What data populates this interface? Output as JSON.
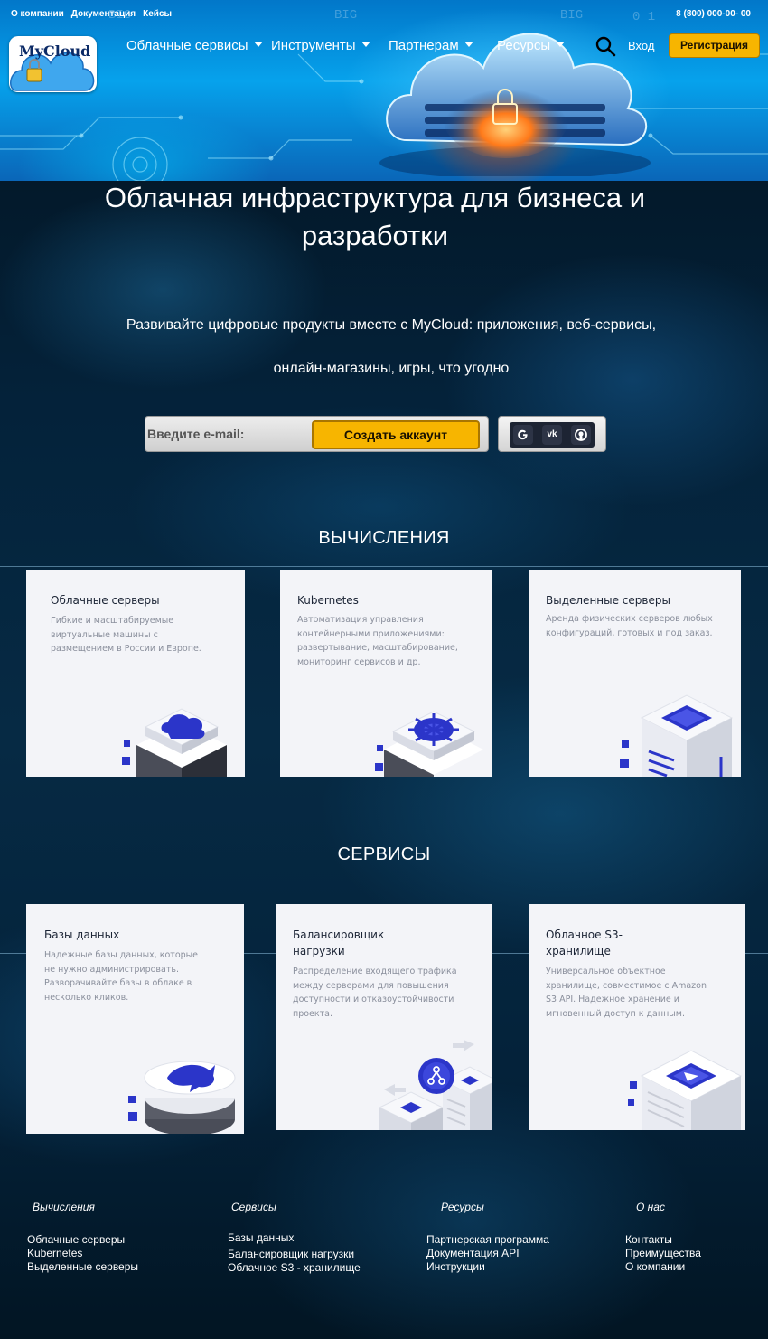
{
  "top_links": [
    "О компании",
    "Документация",
    "Кейсы"
  ],
  "phone": "8 (800) 000-00- 00",
  "logo_text": "MyCloud",
  "nav": [
    {
      "label": "Облачные сервисы"
    },
    {
      "label": "Инструменты"
    },
    {
      "label": "Партнерам"
    },
    {
      "label": "Ресурсы"
    }
  ],
  "login_label": "Вход",
  "register_label": "Регистрация",
  "headline": "Облачная инфраструктура для бизнеса и разработки",
  "subtitle_line1": "Развивайте цифровые продукты вместе с MyCloud: приложения, веб-сервисы,",
  "subtitle_line2": "онлайн-магазины, игры, что угодно",
  "signup": {
    "email_placeholder": "Введите e-mail:",
    "create_label": "Создать аккаунт",
    "social_icons": [
      "google-icon",
      "vk-icon",
      "github-icon"
    ]
  },
  "compute": {
    "title": "ВЫЧИСЛЕНИЯ",
    "cards": [
      {
        "title": "Облачные серверы",
        "desc": "Гибкие и масштабируемые виртуальные машины с размещением в России и Европе."
      },
      {
        "title": "Kubernetes",
        "desc": "Автоматизация управления контейнерными приложениями: развертывание, масштабирование, мониторинг сервисов и др."
      },
      {
        "title": "Выделенные серверы",
        "desc": "Аренда физических серверов любых конфигураций, готовых и под заказ."
      }
    ]
  },
  "services": {
    "title": "СЕРВИСЫ",
    "cards": [
      {
        "title": "Базы данных",
        "desc": "Надежные базы данных, которые не нужно администрировать. Разворачивайте базы в облаке в несколько кликов."
      },
      {
        "title": "Балансировщик нагрузки",
        "desc": "Распределение входящего трафика между серверами для повышения доступности и отказоустойчивости проекта."
      },
      {
        "title": "Облачное S3-хранилище",
        "desc": "Универсальное объектное хранилище, совместимое с Amazon S3 API. Надежное хранение и мгновенный доступ к данным."
      }
    ]
  },
  "footer": [
    {
      "heading": "Вычисления",
      "links": [
        "Облачные серверы",
        "Kubernetes",
        "Выделенные серверы"
      ]
    },
    {
      "heading": "Сервисы",
      "links": [
        "Базы данных",
        "Балансировщик нагрузки",
        "Облачное S3 - хранилище"
      ]
    },
    {
      "heading": "Ресурсы",
      "links": [
        "Партнерская программа",
        "Документация API",
        "Инструкции"
      ]
    },
    {
      "heading": "О нас",
      "links": [
        "Контакты",
        "Преимущества",
        "О компании"
      ]
    }
  ],
  "colors": {
    "accent": "#f7b500",
    "hero_blue": "#06a2ec",
    "card_bg": "#f3f4f8",
    "iso_blue": "#2b35c9"
  }
}
